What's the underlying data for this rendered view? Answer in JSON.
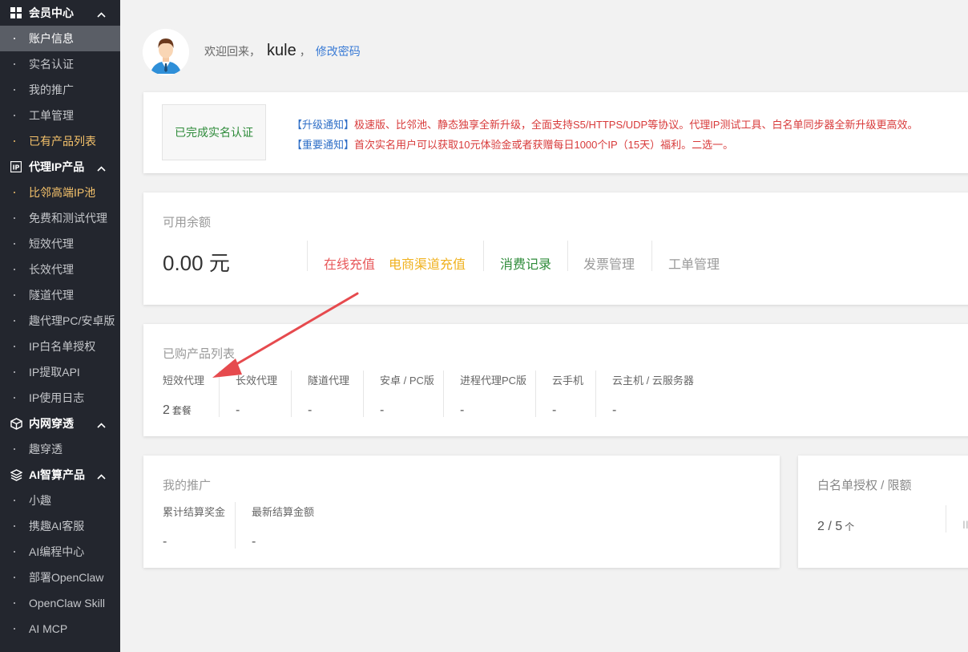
{
  "sidebar": {
    "groups": [
      {
        "title": "会员中心",
        "icon": "grid-icon",
        "items": [
          {
            "label": "账户信息",
            "state": "active"
          },
          {
            "label": "实名认证",
            "state": ""
          },
          {
            "label": "我的推广",
            "state": ""
          },
          {
            "label": "工单管理",
            "state": ""
          },
          {
            "label": "已有产品列表",
            "state": "orange"
          }
        ]
      },
      {
        "title": "代理IP产品",
        "icon": "ip-icon",
        "items": [
          {
            "label": "比邻高端IP池",
            "state": "orange"
          },
          {
            "label": "免费和测试代理",
            "state": ""
          },
          {
            "label": "短效代理",
            "state": ""
          },
          {
            "label": "长效代理",
            "state": ""
          },
          {
            "label": "隧道代理",
            "state": ""
          },
          {
            "label": "趣代理PC/安卓版",
            "state": ""
          },
          {
            "label": "IP白名单授权",
            "state": ""
          },
          {
            "label": "IP提取API",
            "state": ""
          },
          {
            "label": "IP使用日志",
            "state": ""
          }
        ]
      },
      {
        "title": "内网穿透",
        "icon": "cube-icon",
        "items": [
          {
            "label": "趣穿透",
            "state": ""
          }
        ]
      },
      {
        "title": "AI智算产品",
        "icon": "layers-icon",
        "items": [
          {
            "label": "小趣",
            "state": ""
          },
          {
            "label": "携趣AI客服",
            "state": ""
          },
          {
            "label": "AI编程中心",
            "state": ""
          },
          {
            "label": "部署OpenClaw",
            "state": ""
          },
          {
            "label": "OpenClaw Skill",
            "state": ""
          },
          {
            "label": "AI MCP",
            "state": ""
          }
        ]
      }
    ]
  },
  "header": {
    "welcome": "欢迎回来，",
    "username": "kule",
    "comma": "，",
    "change_password": "修改密码"
  },
  "notice_card": {
    "realname_status": "已完成实名认证",
    "notices": [
      {
        "tag": "【升级通知】",
        "text": "极速版、比邻池、静态独享全新升级，全面支持S5/HTTPS/UDP等协议。代理IP测试工具、白名单同步器全新升级更高效。"
      },
      {
        "tag": "【重要通知】",
        "text": "首次实名用户可以获取10元体验金或者获赠每日1000个IP（15天）福利。二选一。"
      }
    ]
  },
  "balance_card": {
    "label": "可用余额",
    "value": "0.00 元",
    "actions": [
      {
        "label": "在线充值",
        "color": "#e8585a"
      },
      {
        "label": "电商渠道充值",
        "color": "#f0b21f"
      },
      {
        "label": "消费记录",
        "color": "#2e8b3a"
      },
      {
        "label": "发票管理",
        "color": "#999999"
      },
      {
        "label": "工单管理",
        "color": "#999999"
      }
    ]
  },
  "products_card": {
    "title": "已购产品列表",
    "columns": [
      {
        "name": "短效代理",
        "value": "2",
        "unit": "套餐"
      },
      {
        "name": "长效代理",
        "value": "-",
        "unit": ""
      },
      {
        "name": "隧道代理",
        "value": "-",
        "unit": ""
      },
      {
        "name": "安卓 / PC版",
        "value": "-",
        "unit": ""
      },
      {
        "name": "进程代理PC版",
        "value": "-",
        "unit": ""
      },
      {
        "name": "云手机",
        "value": "-",
        "unit": ""
      },
      {
        "name": "云主机 / 云服务器",
        "value": "-",
        "unit": ""
      }
    ]
  },
  "promo_card": {
    "title": "我的推广",
    "columns": [
      {
        "name": "累计结算奖金",
        "value": "-"
      },
      {
        "name": "最新结算金额",
        "value": "-"
      }
    ]
  },
  "whitelist_card": {
    "title": "白名单授权 / 限额",
    "value": "2 / 5",
    "unit": "个",
    "cut_text": "II"
  }
}
